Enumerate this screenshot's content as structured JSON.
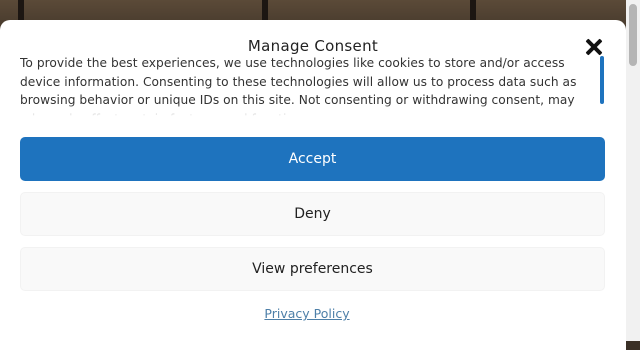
{
  "consent": {
    "title": "Manage Consent",
    "message": "To provide the best experiences, we use technologies like cookies to store and/or access device information. Consenting to these technologies will allow us to process data such as browsing behavior or unique IDs on this site. Not consenting or withdrawing consent, may adversely affect certain features and functions.",
    "buttons": {
      "accept": "Accept",
      "deny": "Deny",
      "preferences": "View preferences"
    },
    "privacy_link": "Privacy Policy",
    "close_icon": "close-icon"
  },
  "colors": {
    "accent": "#1e73be",
    "secondary_button": "#f9f9f9",
    "link": "#4d7fa8"
  }
}
